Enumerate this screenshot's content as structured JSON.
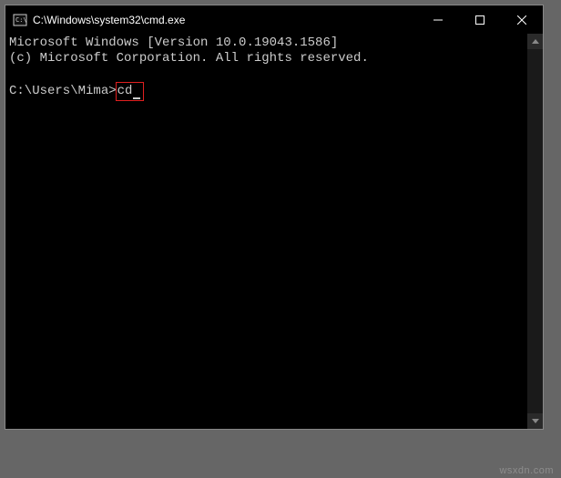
{
  "window": {
    "title": "C:\\Windows\\system32\\cmd.exe"
  },
  "terminal": {
    "line1": "Microsoft Windows [Version 10.0.19043.1586]",
    "line2": "(c) Microsoft Corporation. All rights reserved.",
    "prompt": "C:\\Users\\Mima>",
    "command": "cd"
  },
  "watermark": "wsxdn.com"
}
